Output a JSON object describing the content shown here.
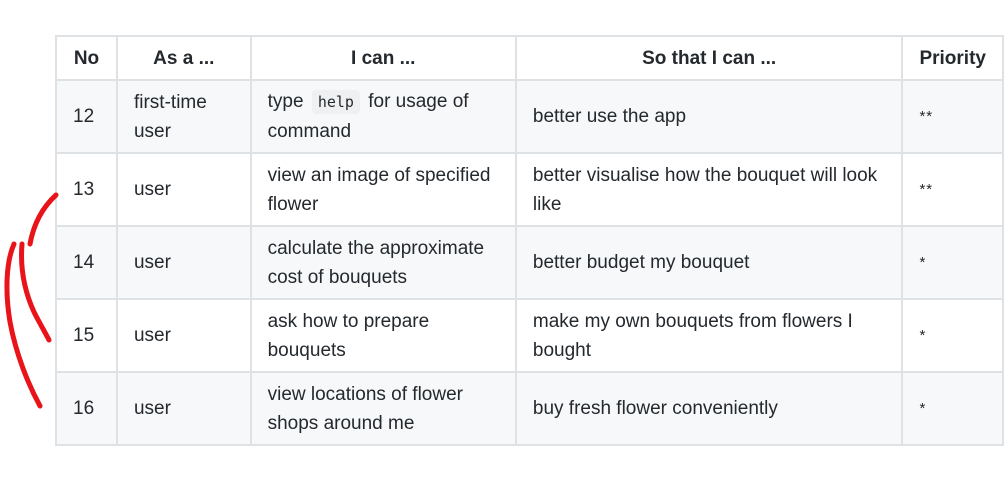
{
  "table": {
    "headers": {
      "no": "No",
      "as_a": "As a ...",
      "i_can": "I can ...",
      "so_that": "So that I can ...",
      "priority": "Priority"
    },
    "rows": [
      {
        "no": "12",
        "role": "first-time user",
        "action_before": "type",
        "action_code": "help",
        "action_after": "for usage of command",
        "benefit": "better use the app",
        "priority": "**"
      },
      {
        "no": "13",
        "role": "user",
        "action": "view an image of specified flower",
        "benefit": "better visualise how the bouquet will look like",
        "priority": "**"
      },
      {
        "no": "14",
        "role": "user",
        "action": "calculate the approximate cost of bouquets",
        "benefit": "better budget my bouquet",
        "priority": "*"
      },
      {
        "no": "15",
        "role": "user",
        "action": "ask how to prepare bouquets",
        "benefit": "make my own bouquets from flowers I bought",
        "priority": "*"
      },
      {
        "no": "16",
        "role": "user",
        "action": "view locations of flower shops around me",
        "benefit": "buy fresh flower conveniently",
        "priority": "*"
      }
    ]
  },
  "annotation": {
    "stroke_color": "#e8141a"
  }
}
